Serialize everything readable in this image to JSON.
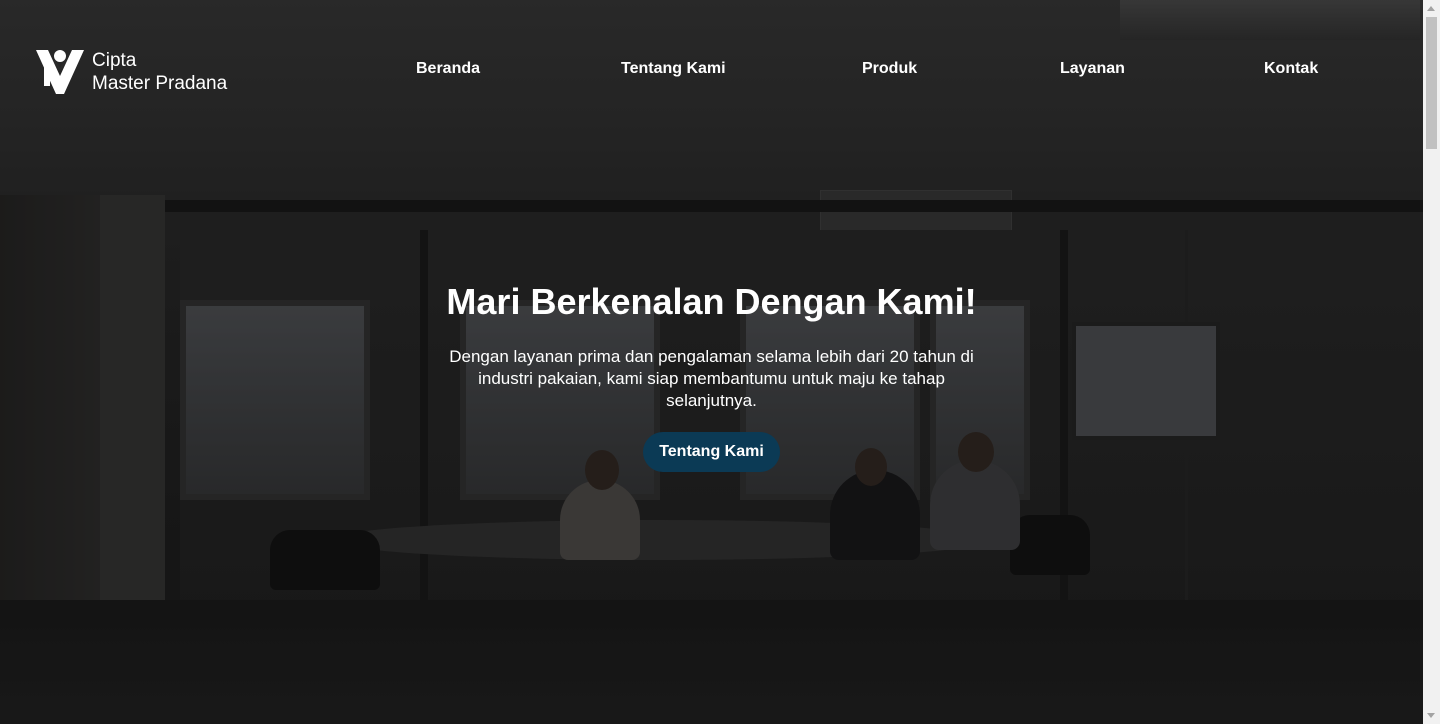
{
  "brand": {
    "line1": "Cipta",
    "line2": "Master Pradana",
    "logo_icon": "vm-logo-icon"
  },
  "nav": {
    "items": [
      {
        "label": "Beranda"
      },
      {
        "label": "Tentang Kami"
      },
      {
        "label": "Produk"
      },
      {
        "label": "Layanan"
      },
      {
        "label": "Kontak"
      }
    ]
  },
  "hero": {
    "title": "Mari Berkenalan Dengan Kami!",
    "subtitle": "Dengan layanan prima dan pengalaman selama lebih dari 20 tahun di industri pakaian, kami siap membantumu untuk maju ke tahap selanjutnya.",
    "button_label": "Tentang Kami",
    "button_color": "#0b3a55"
  }
}
